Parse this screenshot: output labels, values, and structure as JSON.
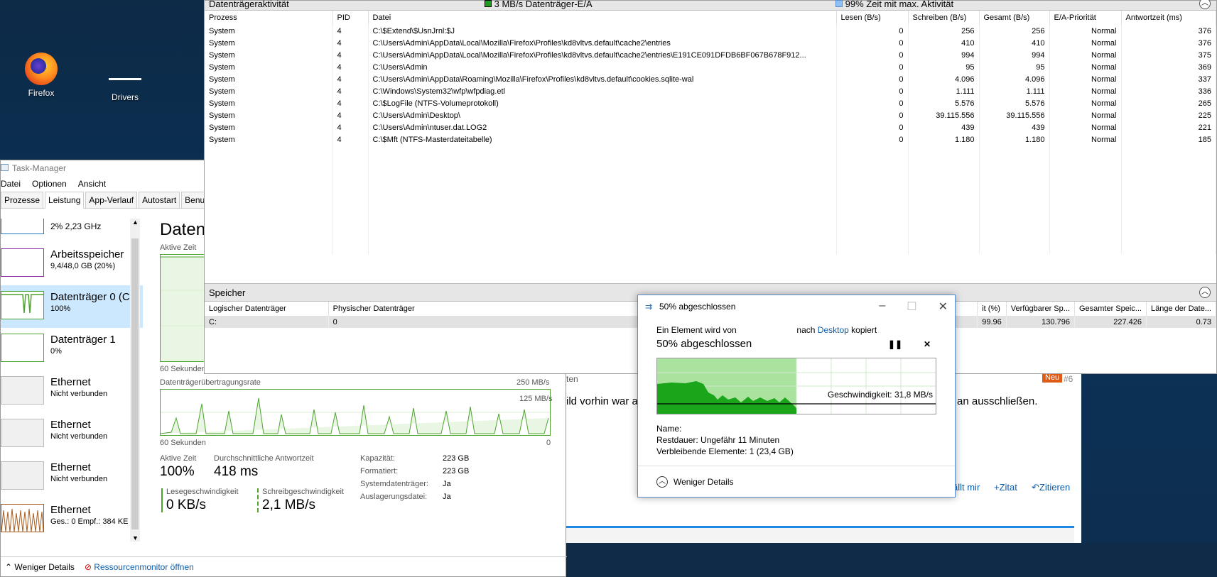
{
  "desktop": {
    "icons": [
      {
        "label": "Firefox"
      },
      {
        "label": "Drivers"
      }
    ]
  },
  "taskmanager": {
    "title": "Task-Manager",
    "menu": [
      "Datei",
      "Optionen",
      "Ansicht"
    ],
    "tabs": [
      "Prozesse",
      "Leistung",
      "App-Verlauf",
      "Autostart",
      "Benutze"
    ],
    "active_tab": "Leistung",
    "items": [
      {
        "name": "",
        "sub": "2% 2,23 GHz"
      },
      {
        "name": "Arbeitsspeicher",
        "sub": "9,4/48,0 GB (20%)"
      },
      {
        "name": "Datenträger 0 (C",
        "sub": "100%"
      },
      {
        "name": "Datenträger 1",
        "sub": "0%"
      },
      {
        "name": "Ethernet",
        "sub": "Nicht verbunden"
      },
      {
        "name": "Ethernet",
        "sub": "Nicht verbunden"
      },
      {
        "name": "Ethernet",
        "sub": "Nicht verbunden"
      },
      {
        "name": "Ethernet",
        "sub": "Ges.: 0 Empf.: 384 KE"
      }
    ],
    "panel": {
      "title": "Daten",
      "graph1_label": "Aktive Zeit",
      "graph1_left": "60 Sekunden",
      "graph1_right": "0",
      "graph2_label": "Datenträgerübertragungsrate",
      "graph2_max": "250 MB/s",
      "graph2_mid": "125 MB/s",
      "graph2_left": "60 Sekunden",
      "graph2_right": "0",
      "stats": {
        "active_label": "Aktive Zeit",
        "active_val": "100%",
        "resp_label": "Durchschnittliche Antwortzeit",
        "resp_val": "418 ms",
        "read_label": "Lesegeschwindigkeit",
        "read_val": "0 KB/s",
        "write_label": "Schreibgeschwindigkeit",
        "write_val": "2,1 MB/s"
      },
      "props": [
        {
          "k": "Kapazität:",
          "v": "223 GB"
        },
        {
          "k": "Formatiert:",
          "v": "223 GB"
        },
        {
          "k": "Systemdatenträger:",
          "v": "Ja"
        },
        {
          "k": "Auslagerungsdatei:",
          "v": "Ja"
        }
      ]
    },
    "footer": {
      "less": "Weniger Details",
      "resmon": "Ressourcenmonitor öffnen"
    }
  },
  "resmon": {
    "section_title": "Datenträgeraktivität",
    "io_label": "3 MB/s Datenträger-E/A",
    "active_label": "99% Zeit mit max. Aktivität",
    "columns": [
      "Prozess",
      "PID",
      "Datei",
      "Lesen (B/s)",
      "Schreiben (B/s)",
      "Gesamt (B/s)",
      "E/A-Priorität",
      "Antwortzeit (ms)"
    ],
    "rows": [
      [
        "System",
        "4",
        "C:\\$Extend\\$UsnJrnl:$J",
        "0",
        "256",
        "256",
        "Normal",
        "376"
      ],
      [
        "System",
        "4",
        "C:\\Users\\Admin\\AppData\\Local\\Mozilla\\Firefox\\Profiles\\kd8vltvs.default\\cache2\\entries",
        "0",
        "410",
        "410",
        "Normal",
        "376"
      ],
      [
        "System",
        "4",
        "C:\\Users\\Admin\\AppData\\Local\\Mozilla\\Firefox\\Profiles\\kd8vltvs.default\\cache2\\entries\\E191CE091DFDB6BF067B678F912...",
        "0",
        "994",
        "994",
        "Normal",
        "375"
      ],
      [
        "System",
        "4",
        "C:\\Users\\Admin",
        "0",
        "95",
        "95",
        "Normal",
        "369"
      ],
      [
        "System",
        "4",
        "C:\\Users\\Admin\\AppData\\Roaming\\Mozilla\\Firefox\\Profiles\\kd8vltvs.default\\cookies.sqlite-wal",
        "0",
        "4.096",
        "4.096",
        "Normal",
        "337"
      ],
      [
        "System",
        "4",
        "C:\\Windows\\System32\\wfp\\wfpdiag.etl",
        "0",
        "1.111",
        "1.111",
        "Normal",
        "336"
      ],
      [
        "System",
        "4",
        "C:\\$LogFile (NTFS-Volumeprotokoll)",
        "0",
        "5.576",
        "5.576",
        "Normal",
        "265"
      ],
      [
        "System",
        "4",
        "C:\\Users\\Admin\\Desktop\\",
        "0",
        "39.115.556",
        "39.115.556",
        "Normal",
        "225"
      ],
      [
        "System",
        "4",
        "C:\\Users\\Admin\\ntuser.dat.LOG2",
        "0",
        "439",
        "439",
        "Normal",
        "221"
      ],
      [
        "System",
        "4",
        "C:\\$Mft (NTFS-Masterdateitabelle)",
        "0",
        "1.180",
        "1.180",
        "Normal",
        "185"
      ]
    ],
    "storage": {
      "title": "Speicher",
      "columns": [
        "Logischer Datenträger",
        "Physischer Datenträger",
        "it (%)",
        "Verfügbarer Sp...",
        "Gesamter Speic...",
        "Länge der Date..."
      ],
      "row": [
        "C:",
        "0",
        "99.96",
        "130.796",
        "227.426",
        "0.73"
      ]
    }
  },
  "copydialog": {
    "title": "50% abgeschlossen",
    "from_text": "Ein Element wird von",
    "to_text": "nach",
    "dest": "Desktop",
    "copied": "kopiert",
    "progress_text": "50% abgeschlossen",
    "progress": 0.5,
    "speed": "Geschwindigkeit: 31,8 MB/s",
    "name_label": "Name:",
    "remaining_label": "Restdauer:",
    "remaining_val": "Ungefähr 11 Minuten",
    "items_label": "Verbleibende Elemente:",
    "items_val": "1 (23,4 GB)",
    "less": "Weniger Details"
  },
  "forum": {
    "badge": "Neu",
    "post_num": "#6",
    "text_left": "ild vorhin war a",
    "text_right": "an ausschließen.",
    "actions": [
      "ällt mir",
      "Zitat",
      "Zitieren"
    ],
    "tab_fragment": "ten"
  },
  "colors": {
    "accent": "#0b5ca8",
    "graph_green": "#4ca42e",
    "selected": "#cce8ff"
  }
}
